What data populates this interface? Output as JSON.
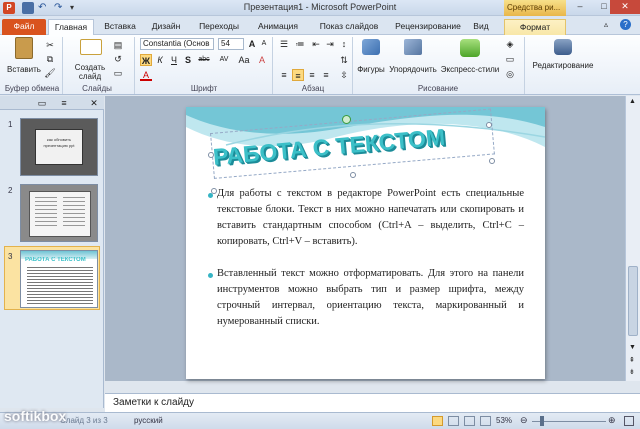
{
  "window": {
    "title": "Презентация1 - Microsoft PowerPoint",
    "context_tab_group": "Средства ри...",
    "minimize": "–",
    "maximize": "□",
    "close": "✕"
  },
  "tabs": [
    "Файл",
    "Главная",
    "Вставка",
    "Дизайн",
    "Переходы",
    "Анимация",
    "Показ слайдов",
    "Рецензирование",
    "Вид",
    "Формат"
  ],
  "ribbon": {
    "clipboard": {
      "paste": "Вставить",
      "label": "Буфер обмена"
    },
    "slides": {
      "create": "Создать слайд",
      "label": "Слайды"
    },
    "font": {
      "name": "Constantia (Основ",
      "size": "54",
      "label": "Шрифт",
      "bold": "Ж",
      "italic": "К",
      "underline": "Ч",
      "shadow": "S",
      "strike": "abc",
      "spacing": "AV",
      "case": "Aa",
      "color": "A",
      "grow": "A",
      "shrink": "A",
      "clear": "A"
    },
    "paragraph": {
      "label": "Абзац"
    },
    "drawing": {
      "shapes": "Фигуры",
      "arrange": "Упорядочить",
      "styles": "Экспресс-стили",
      "label": "Рисование"
    },
    "editing": {
      "label": "Редактирование"
    }
  },
  "thumbnails": [
    {
      "num": "1",
      "text": "как обновить презентацию ppt"
    },
    {
      "num": "2",
      "text": ""
    },
    {
      "num": "3",
      "text": "РАБОТА С ТЕКСТОМ"
    }
  ],
  "slide": {
    "title": "РАБОТА С ТЕКСТОМ",
    "bullets": [
      "Для работы с текстом в редакторе PowerPoint есть специальные текстовые блоки. Текст в них можно напечатать или скопировать и вставить стандартным способом (Ctrl+A – выделить, Ctrl+C – копировать, Ctrl+V – вставить).",
      "Вставленный текст можно отформатировать. Для этого на панели инструментов можно выбрать тип и размер шрифта, между строчный интервал, ориентацию текста, маркированный и нумерованный списки."
    ]
  },
  "notes": {
    "placeholder": "Заметки к слайду"
  },
  "status": {
    "slide_info": "Слайд 3 из 3",
    "theme": "русский",
    "zoom": "53%"
  },
  "watermark": "softikbox"
}
